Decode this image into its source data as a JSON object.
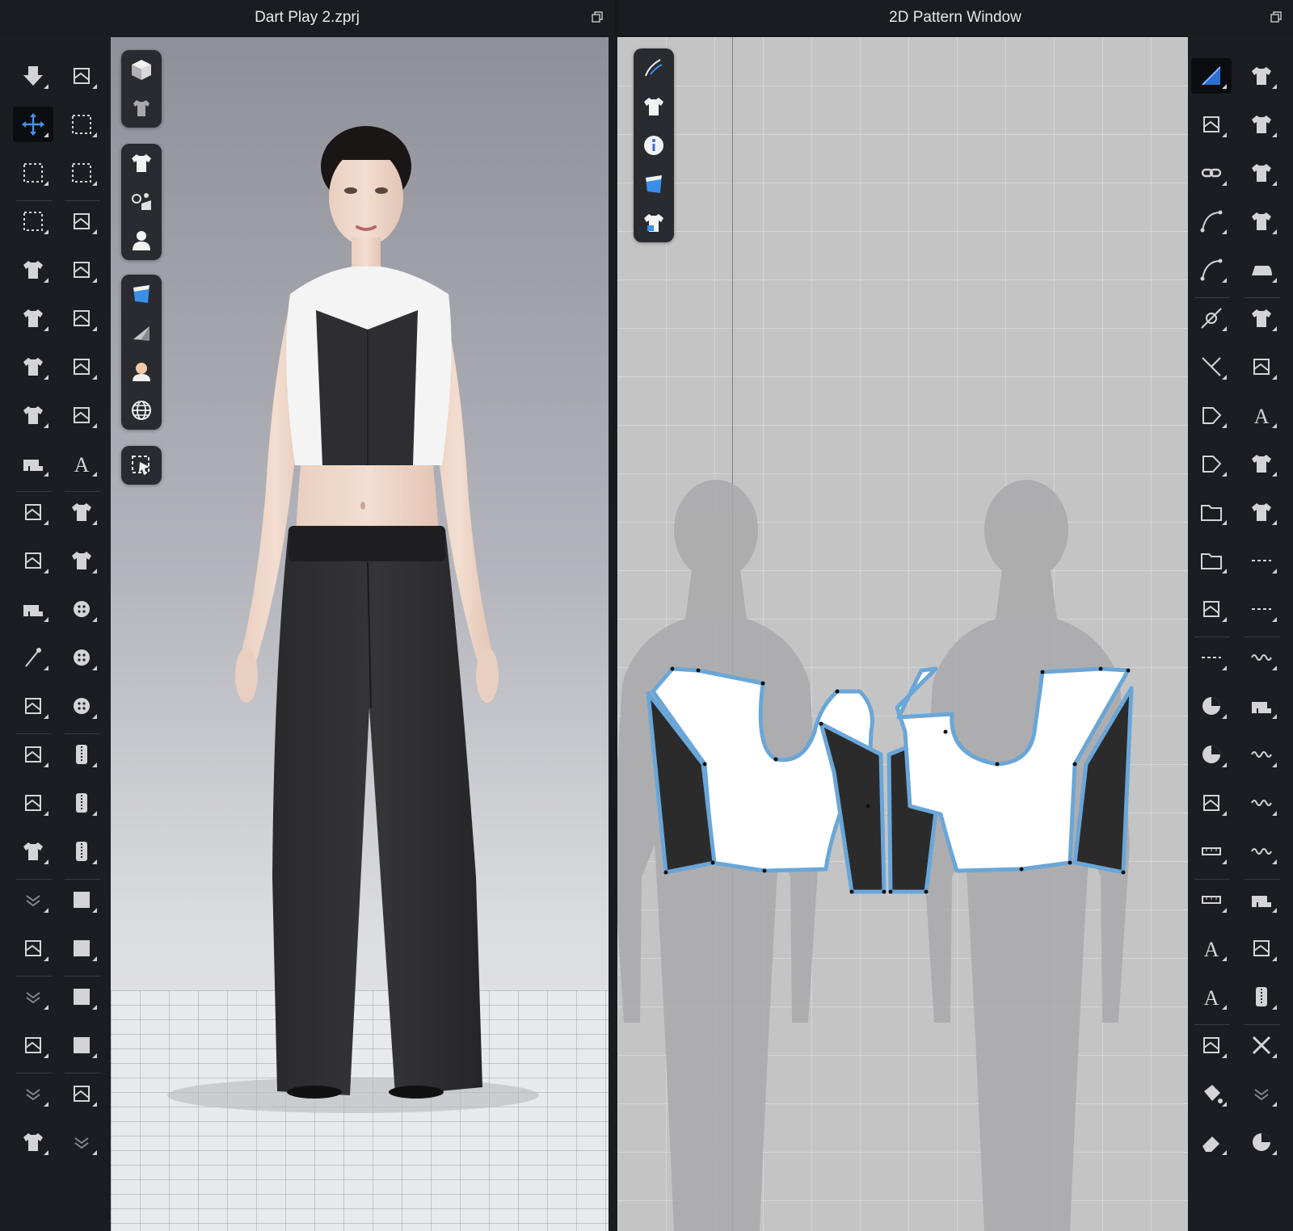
{
  "windows": {
    "left_title": "Dart Play 2.zprj",
    "right_title": "2D Pattern Window"
  },
  "icons": {
    "restore": "restore-window-icon",
    "colors": {
      "panel_bg": "#1c1d22",
      "active_tool": "#0c0d10",
      "accent_blue": "#4a90e2",
      "pattern_outline": "#6aa6d8",
      "fabric_white": "#ffffff",
      "fabric_black": "#2b2b2b"
    }
  },
  "left_toolbar_icons": [
    "drop-avatar-icon",
    "walking-avatar-icon",
    "transform-move-icon",
    "select-mesh-icon",
    "lasso-select-icon",
    "brush-select-icon",
    "box-select-icon",
    "fold-arrangement-icon",
    "garment-shape-icon",
    "tack-icon",
    "garment-shape-2-icon",
    "tack-2-icon",
    "garment-move-icon",
    "tack-3-icon",
    "garment-pin-icon",
    "tack-edit-icon",
    "sewing-machine-icon",
    "texture-brush-icon",
    "sewing-segment-icon",
    "garment-checker-icon",
    "sewing-free-icon",
    "garment-checker-2-icon",
    "sewing-machine-2-icon",
    "button-add-icon",
    "pin-icon",
    "button-icon",
    "puckering-icon",
    "buttonhole-icon",
    "strap-icon",
    "zipper-lock-icon",
    "fold-3d-icon",
    "zipper-icon",
    "shirt-fold-icon",
    "zipper-2-icon",
    "expand-more-icon",
    "fabric-flat-icon",
    "avatar-measure-icon",
    "fabric-flat-2-icon",
    "expand-more-2-icon",
    "fabric-roll-icon",
    "tape-icon",
    "fabric-roll-2-icon",
    "expand-more-3-icon",
    "fold-marker-icon",
    "measure-garment-icon",
    "expand-more-4-icon"
  ],
  "right_toolbar_icons": [
    "edit-pattern-icon",
    "sewing-pattern-icon",
    "edit-point-icon",
    "sewing-pattern-2-icon",
    "link-icon",
    "sewing-pattern-3-icon",
    "curve-point-icon",
    "sewing-pattern-4-icon",
    "edit-curvature-icon",
    "iron-icon",
    "add-point-icon",
    "shirt-icon",
    "cut-line-icon",
    "symmetry-icon",
    "polygon-icon",
    "texture-edit-icon",
    "internal-polygon-icon",
    "checker-shirt-icon",
    "folder-icon",
    "checker-shirt-2-icon",
    "folder-2-icon",
    "dashed-line-icon",
    "shirring-icon",
    "dashed-line-2-icon",
    "box-dashed-icon",
    "wave-line-icon",
    "pattern-piece-icon",
    "sewing-machine-3-icon",
    "pattern-piece-2-icon",
    "elastic-icon",
    "fold-arrange-icon",
    "elastic-2-icon",
    "ruler-vertical-icon",
    "elastic-3-icon",
    "ruler-horizontal-icon",
    "sewing-machine-4-icon",
    "text-icon",
    "add-sewing-icon",
    "text-2-icon",
    "zipper-3-icon",
    "dart-icon",
    "cross-icon",
    "fill-icon",
    "expand-more-5-icon",
    "eraser-icon",
    "pie-icon"
  ],
  "palette_3d": {
    "group1": [
      "cube-view-icon",
      "shirt-avatar-icon"
    ],
    "group2": [
      "shirt-icon",
      "avatar-settings-icon",
      "avatar-icon"
    ],
    "group3": [
      "fabric-texture-icon",
      "fabric-shade-icon",
      "skin-icon",
      "globe-icon"
    ],
    "group4": [
      "select-arrow-box-icon"
    ]
  },
  "palette_2d": [
    "pen-icon",
    "shirt-icon",
    "info-icon",
    "fabric-texture-icon",
    "shirt-lock-icon"
  ]
}
